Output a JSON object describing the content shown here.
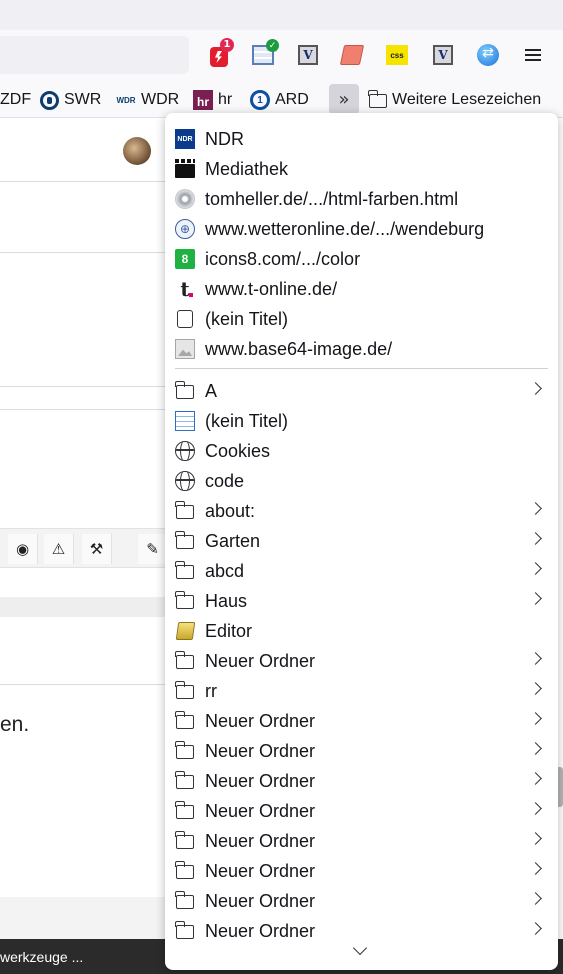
{
  "extensions": {
    "red_badge": "1",
    "v_label": "V",
    "css_label": "css"
  },
  "bookmarks_bar": {
    "items": [
      {
        "label": "ZDF"
      },
      {
        "label": "SWR",
        "icon": "swr-icon"
      },
      {
        "label": "WDR",
        "icon": "wdr-icon",
        "icon_text": "WDR"
      },
      {
        "label": "hr",
        "icon": "hr-icon",
        "icon_text": "hr"
      },
      {
        "label": "ARD",
        "icon": "ard-icon",
        "icon_text": "1"
      }
    ],
    "overflow_label": "»",
    "other_bookmarks": "Weitere Lesezeichen"
  },
  "page": {
    "partial_text": "en.",
    "tool_icons": [
      "globe-icon",
      "warning-icon",
      "gavel-icon",
      "pencil-icon"
    ]
  },
  "taskbar": {
    "label": "werkzeuge ..."
  },
  "popup": {
    "bookmarks": [
      {
        "label": "NDR",
        "icon": "ndr-icon",
        "icon_text": "NDR"
      },
      {
        "label": "Mediathek",
        "icon": "clapperboard-icon"
      },
      {
        "label": "tomheller.de/.../html-farben.html",
        "icon": "disk-icon"
      },
      {
        "label": "www.wetteronline.de/.../wendeburg",
        "icon": "wetteronline-icon"
      },
      {
        "label": "icons8.com/.../color",
        "icon": "icons8-icon",
        "icon_text": "8"
      },
      {
        "label": "www.t-online.de/",
        "icon": "t-online-icon",
        "icon_text": "t"
      },
      {
        "label": "(kein Titel)",
        "icon": "extension-icon"
      },
      {
        "label": "www.base64-image.de/",
        "icon": "image-icon"
      }
    ],
    "items": [
      {
        "label": "A",
        "icon": "folder-icon",
        "submenu": true
      },
      {
        "label": "(kein Titel)",
        "icon": "table-icon",
        "submenu": false
      },
      {
        "label": "Cookies",
        "icon": "globe-icon",
        "submenu": false
      },
      {
        "label": "code",
        "icon": "globe-icon",
        "submenu": false
      },
      {
        "label": "about:",
        "icon": "folder-icon",
        "submenu": true
      },
      {
        "label": "Garten",
        "icon": "folder-icon",
        "submenu": true
      },
      {
        "label": "abcd",
        "icon": "folder-icon",
        "submenu": true
      },
      {
        "label": "Haus",
        "icon": "folder-icon",
        "submenu": true
      },
      {
        "label": "Editor",
        "icon": "editor-icon",
        "submenu": false
      },
      {
        "label": "Neuer Ordner",
        "icon": "folder-icon",
        "submenu": true
      },
      {
        "label": "rr",
        "icon": "folder-icon",
        "submenu": true
      },
      {
        "label": "Neuer Ordner",
        "icon": "folder-icon",
        "submenu": true
      },
      {
        "label": "Neuer Ordner",
        "icon": "folder-icon",
        "submenu": true
      },
      {
        "label": "Neuer Ordner",
        "icon": "folder-icon",
        "submenu": true
      },
      {
        "label": "Neuer Ordner",
        "icon": "folder-icon",
        "submenu": true
      },
      {
        "label": "Neuer Ordner",
        "icon": "folder-icon",
        "submenu": true
      },
      {
        "label": "Neuer Ordner",
        "icon": "folder-icon",
        "submenu": true
      },
      {
        "label": "Neuer Ordner",
        "icon": "folder-icon",
        "submenu": true
      },
      {
        "label": "Neuer Ordner",
        "icon": "folder-icon",
        "submenu": true
      }
    ]
  }
}
